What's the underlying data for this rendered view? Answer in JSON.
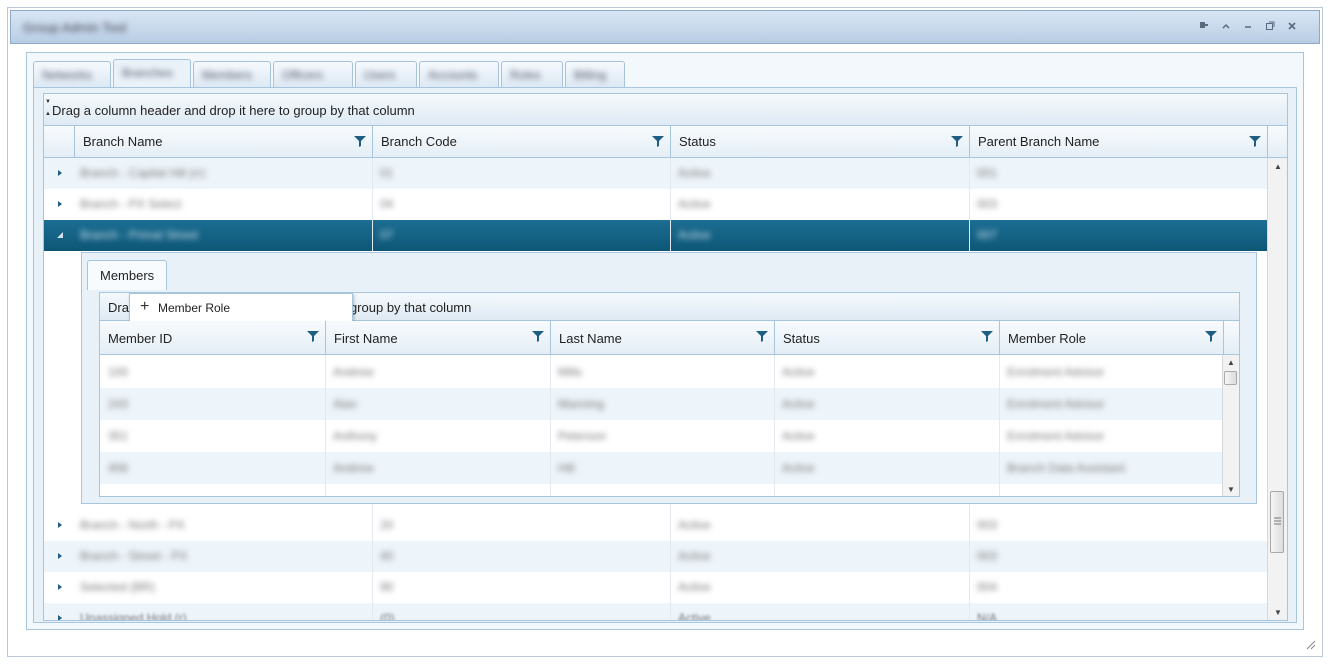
{
  "window": {
    "title": "Group Admin Tool",
    "controls": [
      "pin-icon",
      "collapse-icon",
      "minimize-icon",
      "maximize-icon",
      "close-icon"
    ]
  },
  "tabs": [
    {
      "label": "Networks",
      "active": false
    },
    {
      "label": "Branches",
      "active": true
    },
    {
      "label": "Members",
      "active": false
    },
    {
      "label": "Officers",
      "active": false
    },
    {
      "label": "Users",
      "active": false
    },
    {
      "label": "Accounts",
      "active": false
    },
    {
      "label": "Roles",
      "active": false
    },
    {
      "label": "Billing",
      "active": false
    }
  ],
  "grid": {
    "group_panel_text": "Drag a column header and drop it here to group by that column",
    "columns": [
      "Branch Name",
      "Branch Code",
      "Status",
      "Parent Branch Name"
    ],
    "rows_top": [
      {
        "name": "Branch - Capital Hill (rr)",
        "code": "01",
        "status": "Active",
        "parent": "001"
      },
      {
        "name": "Branch - PX Select",
        "code": "04",
        "status": "Active",
        "parent": "003"
      },
      {
        "name": "Branch - Primal Street",
        "code": "07",
        "status": "Active",
        "parent": "007"
      }
    ],
    "rows_bottom": [
      {
        "name": "Branch - North - PX",
        "code": "20",
        "status": "Active",
        "parent": "003"
      },
      {
        "name": "Branch - Street - PX",
        "code": "40",
        "status": "Active",
        "parent": "003"
      },
      {
        "name": "Selected (BR)",
        "code": "90",
        "status": "Active",
        "parent": "004"
      },
      {
        "name": "Unassigned Hold (r)",
        "code": "(0)",
        "status": "Active",
        "parent": "N/A"
      }
    ]
  },
  "detail": {
    "tab_label": "Members",
    "group_panel_text": "Drag a column header and drop it here to group by that column",
    "group_panel_visible_prefix": "Dra",
    "group_panel_visible_suffix": "group by that column",
    "drag_popup": {
      "label": "Member Role",
      "icon": "plus-icon"
    },
    "columns": [
      "Member ID",
      "First Name",
      "Last Name",
      "Status",
      "Member Role"
    ],
    "rows": [
      {
        "id": "100",
        "first": "Andrew",
        "last": "Mills",
        "status": "Active",
        "role": "Enrolment Advisor"
      },
      {
        "id": "243",
        "first": "Alan",
        "last": "Manning",
        "status": "Active",
        "role": "Enrolment Advisor"
      },
      {
        "id": "351",
        "first": "Anthony",
        "last": "Peterson",
        "status": "Active",
        "role": "Enrolment Advisor"
      },
      {
        "id": "456",
        "first": "Andrew",
        "last": "Hill",
        "status": "Active",
        "role": "Branch Data Assistant"
      }
    ]
  }
}
